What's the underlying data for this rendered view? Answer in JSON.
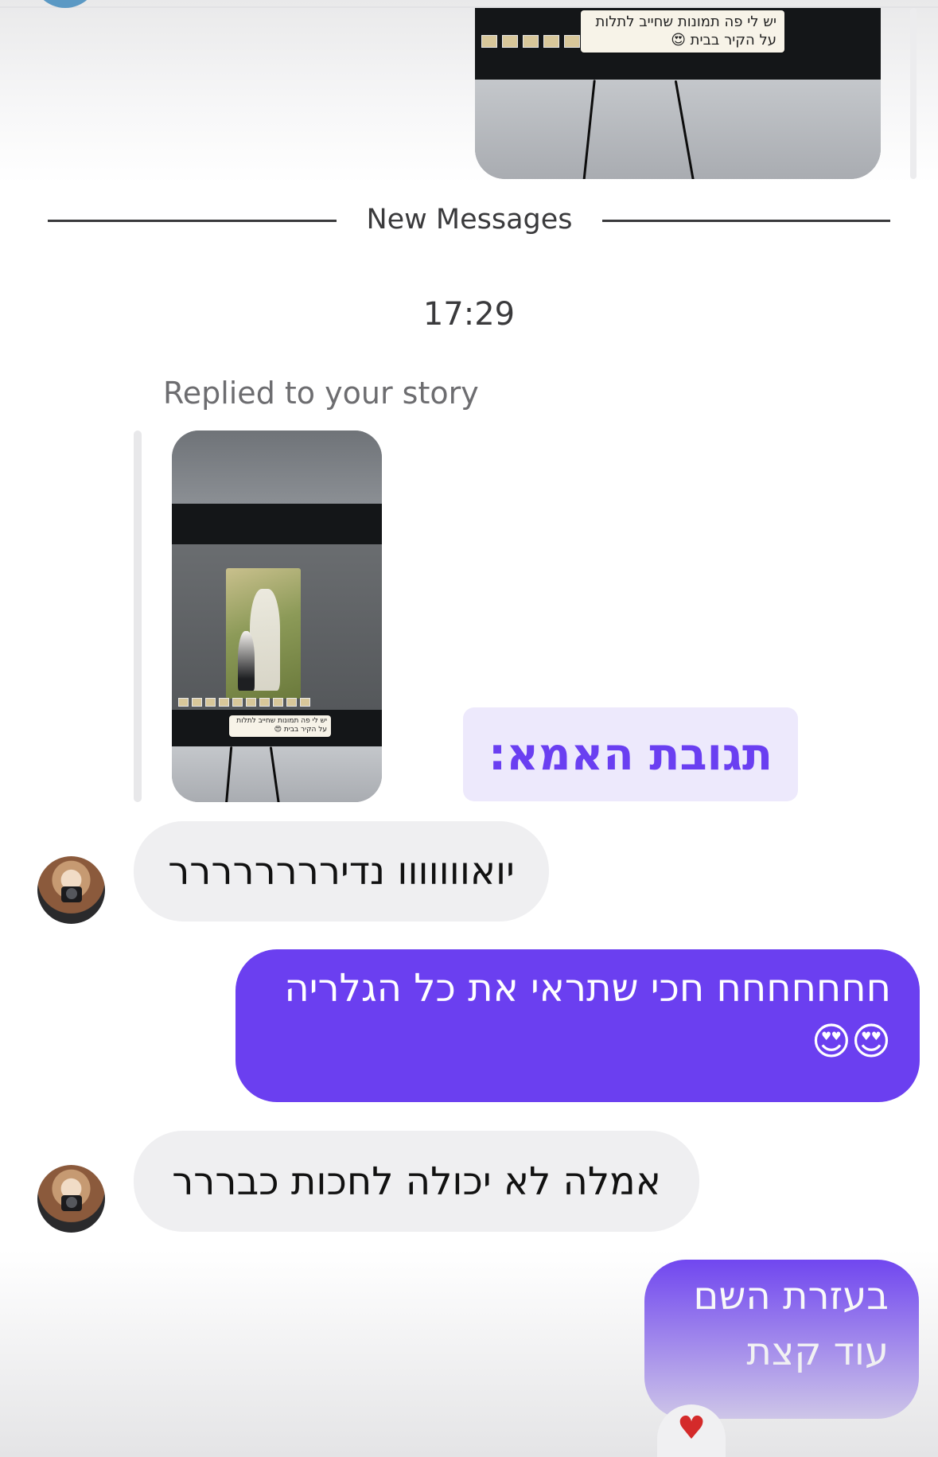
{
  "divider": {
    "label": "New Messages"
  },
  "timestamp": "17:29",
  "story_reply": {
    "label": "Replied to your story",
    "sticker_text": "יש לי פה תמונות שחייב לתלות על הקיר בבית 😍"
  },
  "story_caption": "תגובת האמא:",
  "messages": [
    {
      "direction": "incoming",
      "text": "יואווווווו נדירררררררר"
    },
    {
      "direction": "outgoing",
      "text": "חחחחחחח חכי שתראי את כל הגלריה",
      "emoji": "😍😍"
    },
    {
      "direction": "incoming",
      "text": "אמלה לא יכולה לחכות כבררר"
    },
    {
      "direction": "outgoing",
      "text": "בעזרת השם עוד קצת",
      "reaction": "♥"
    }
  ],
  "colors": {
    "accent": "#6b3ff0",
    "caption_text": "#6a3ff1",
    "caption_bg": "#ede9fc",
    "incoming_bg": "#efeff1"
  }
}
